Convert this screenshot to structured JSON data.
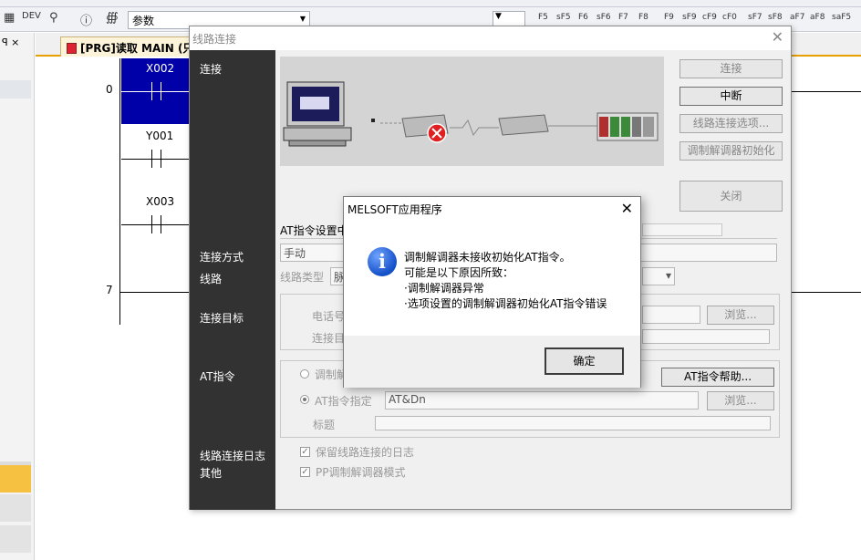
{
  "toolbar": {
    "param_combo": "参数",
    "icons": [
      "dev-icon",
      "search-icon",
      "help-icon",
      "binoculars-icon"
    ],
    "ladder_symbols": [
      "F5",
      "sF5",
      "F6",
      "sF6",
      "F7",
      "F8",
      "F9",
      "sF9",
      "cF9",
      "cF0",
      "sF7",
      "sF8",
      "aF7",
      "aF8",
      "saF5"
    ]
  },
  "left_pane": {
    "pin": "ꟼ ×"
  },
  "editor": {
    "tab_title": "[PRG]读取 MAIN (只",
    "steps": [
      "0",
      "7"
    ],
    "contacts": [
      "X002",
      "Y001",
      "X003"
    ]
  },
  "conn_dialog": {
    "title": "线路连接",
    "sidebar": {
      "connect": "连接",
      "method": "连接方式",
      "line": "线路",
      "target": "连接目标",
      "at_cmd": "AT指令",
      "log": "线路连接日志",
      "other": "其他"
    },
    "buttons": {
      "connect": "连接",
      "interrupt": "中断",
      "line_options": "线路连接选项...",
      "modem_init": "调制解调器初始化",
      "close": "关闭",
      "browse1": "浏览...",
      "at_help": "AT指令帮助...",
      "browse2": "浏览..."
    },
    "status_prefix": "AT指令设置中",
    "method_value": "手动",
    "line_type_label": "线路类型",
    "line_type_value": "脉",
    "phone_label": "电话号",
    "target_label": "连接目",
    "modem_radio": "调制解",
    "at_radio": "AT指令指定",
    "at_value": "AT&Dn",
    "title_label": "标题",
    "log_check": "保留线路连接的日志",
    "pp_check": "PP调制解调器模式"
  },
  "msg_box": {
    "title": "MELSOFT应用程序",
    "lines": [
      "调制解调器未接收初始化AT指令。",
      "可能是以下原因所致：",
      "·调制解调器异常",
      "·选项设置的调制解调器初始化AT指令错误"
    ],
    "ok": "确定",
    "icon": "information-icon"
  },
  "colors": {
    "selection_blue": "#0000a8",
    "dialog_sidebar": "#323232",
    "tab_accent": "#e8a000"
  }
}
